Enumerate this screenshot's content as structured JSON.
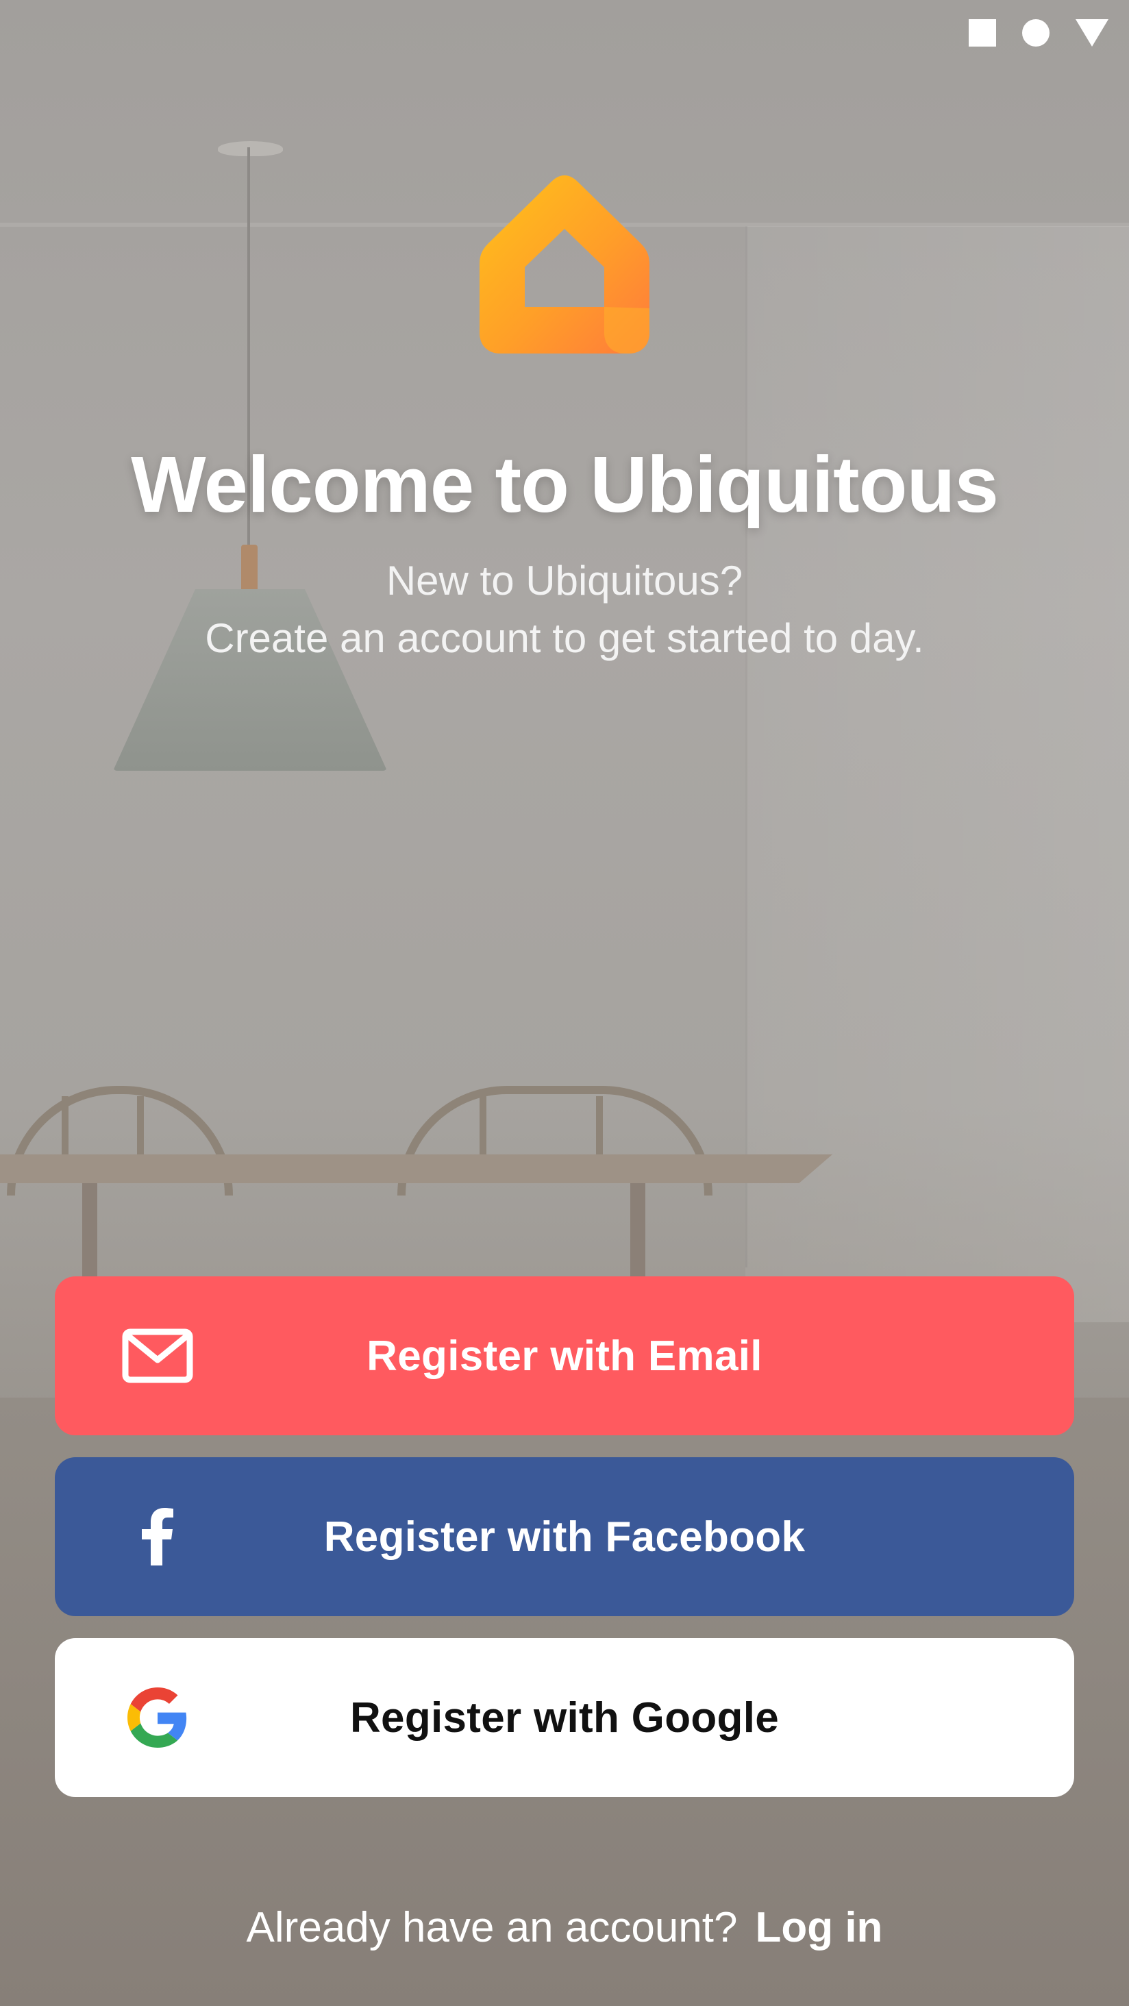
{
  "status_bar": {
    "icons": [
      "square-icon",
      "circle-icon",
      "triangle-icon"
    ]
  },
  "header": {
    "logo_icon": "house-icon",
    "title": "Welcome to Ubiquitous",
    "subtitle_line1": "New to Ubiquitous?",
    "subtitle_line2": "Create an account to get started to day."
  },
  "buttons": {
    "email": {
      "label": "Register with Email",
      "icon": "envelope-icon",
      "color": "#ff5a5f"
    },
    "facebook": {
      "label": "Register with Facebook",
      "icon": "facebook-icon",
      "color": "#3b5998"
    },
    "google": {
      "label": "Register with Google",
      "icon": "google-icon",
      "color": "#ffffff"
    }
  },
  "footer": {
    "prompt": "Already have an account?",
    "login_label": "Log in"
  },
  "colors": {
    "accent_orange": "#ff9a2e",
    "text_on_dark": "#ffffff"
  }
}
